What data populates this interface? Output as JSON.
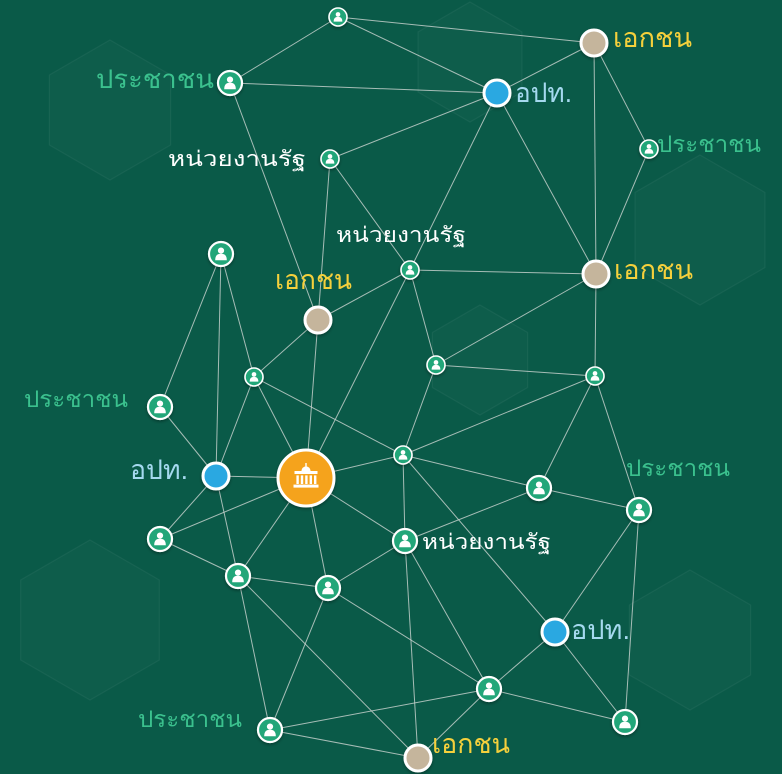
{
  "diagram": {
    "labels": {
      "citizen": [
        "ประชาชน",
        "ประชาชน",
        "ประชาชน",
        "ประชาชน",
        "ประชาชน"
      ],
      "local_gov": [
        "อปท.",
        "อปท.",
        "อปท."
      ],
      "private": [
        "เอกชน",
        "เอกชน",
        "เอกชน",
        "เอกชน"
      ],
      "agency": [
        "หน่วยงานรัฐ",
        "หน่วยงานรัฐ",
        "หน่วยงานรัฐ"
      ]
    },
    "node_groups": {
      "citizen": [
        0,
        1,
        4,
        5,
        6,
        8,
        10,
        11,
        12,
        13,
        16,
        17,
        18,
        19,
        20,
        21,
        22,
        24,
        25,
        26
      ],
      "local_gov": [
        2,
        15,
        23
      ],
      "private": [
        3,
        7,
        9,
        27
      ],
      "hub": [
        14
      ]
    },
    "edges": [
      [
        0,
        1
      ],
      [
        0,
        2
      ],
      [
        0,
        3
      ],
      [
        1,
        2
      ],
      [
        1,
        9
      ],
      [
        2,
        3
      ],
      [
        2,
        4
      ],
      [
        2,
        6
      ],
      [
        2,
        7
      ],
      [
        3,
        5
      ],
      [
        3,
        7
      ],
      [
        4,
        6
      ],
      [
        4,
        9
      ],
      [
        5,
        7
      ],
      [
        6,
        7
      ],
      [
        6,
        9
      ],
      [
        6,
        11
      ],
      [
        6,
        14
      ],
      [
        7,
        11
      ],
      [
        7,
        12
      ],
      [
        8,
        13
      ],
      [
        8,
        15
      ],
      [
        8,
        10
      ],
      [
        9,
        10
      ],
      [
        9,
        14
      ],
      [
        10,
        14
      ],
      [
        10,
        15
      ],
      [
        10,
        16
      ],
      [
        11,
        12
      ],
      [
        11,
        16
      ],
      [
        12,
        17
      ],
      [
        12,
        18
      ],
      [
        12,
        16
      ],
      [
        13,
        15
      ],
      [
        14,
        15
      ],
      [
        15,
        19
      ],
      [
        15,
        21
      ],
      [
        14,
        16
      ],
      [
        14,
        21
      ],
      [
        14,
        22
      ],
      [
        14,
        19
      ],
      [
        14,
        20
      ],
      [
        16,
        17
      ],
      [
        16,
        20
      ],
      [
        16,
        23
      ],
      [
        17,
        18
      ],
      [
        17,
        20
      ],
      [
        18,
        23
      ],
      [
        18,
        25
      ],
      [
        19,
        21
      ],
      [
        20,
        22
      ],
      [
        20,
        24
      ],
      [
        20,
        27
      ],
      [
        21,
        22
      ],
      [
        21,
        26
      ],
      [
        21,
        27
      ],
      [
        22,
        24
      ],
      [
        22,
        26
      ],
      [
        23,
        24
      ],
      [
        23,
        25
      ],
      [
        24,
        26
      ],
      [
        24,
        27
      ],
      [
        24,
        25
      ],
      [
        26,
        27
      ]
    ],
    "icons": {
      "citizen": "person-icon",
      "hub": "government-building-icon"
    },
    "colors": {
      "background": "#0a5a48",
      "edge": "#cdd6d2",
      "node_border": "#ffffff",
      "icon": "#ffffff",
      "citizen": "#22a679",
      "local_gov": "#2ba8e1",
      "private": "#c5b59c",
      "hub": "#f5a31d",
      "citizen_label": "#3bc18e",
      "local_gov_label": "#a5d9ef",
      "private_label": "#f5d03c",
      "agency_label": "#ffffff"
    }
  }
}
